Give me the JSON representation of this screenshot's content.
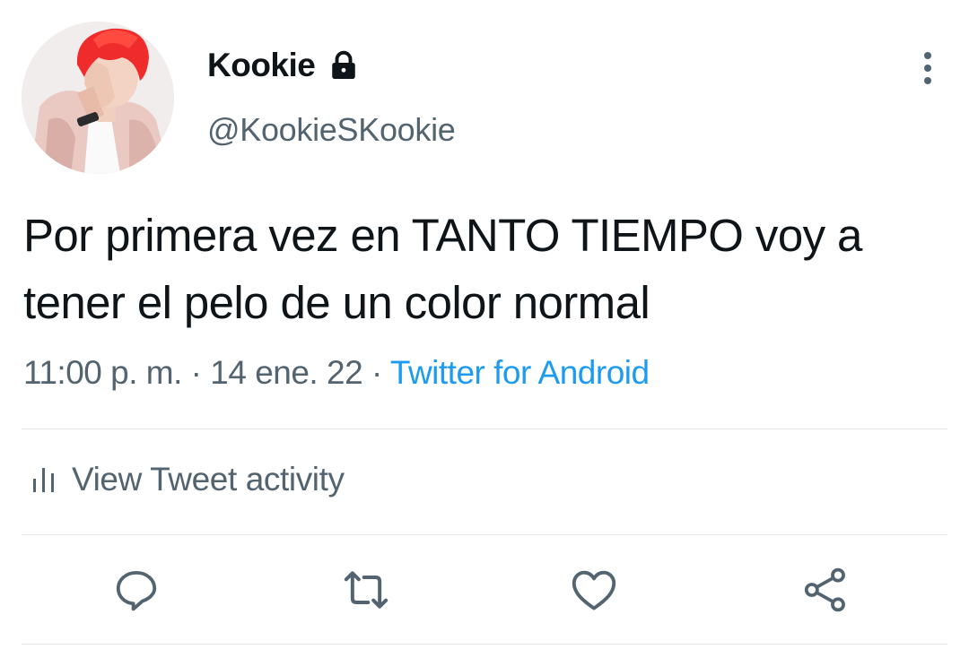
{
  "tweet": {
    "display_name": "Kookie",
    "handle": "@KookieSKookie",
    "text": "Por primera vez en TANTO TIEMPO voy a tener el pelo de un color normal",
    "time": "11:00 p. m.",
    "separator": "·",
    "date": "14 ene. 22",
    "source": "Twitter for Android",
    "protected_icon": "lock-icon",
    "more_icon": "more-vertical-icon"
  },
  "activity": {
    "label": "View Tweet activity",
    "icon": "stats-icon"
  },
  "actions": [
    {
      "name": "reply",
      "icon": "reply-icon"
    },
    {
      "name": "retweet",
      "icon": "retweet-icon"
    },
    {
      "name": "like",
      "icon": "heart-icon"
    },
    {
      "name": "share",
      "icon": "share-icon"
    }
  ],
  "colors": {
    "text": "#0f1419",
    "secondary": "#536471",
    "link": "#1d9bf0",
    "divider": "#e6e9ec"
  }
}
